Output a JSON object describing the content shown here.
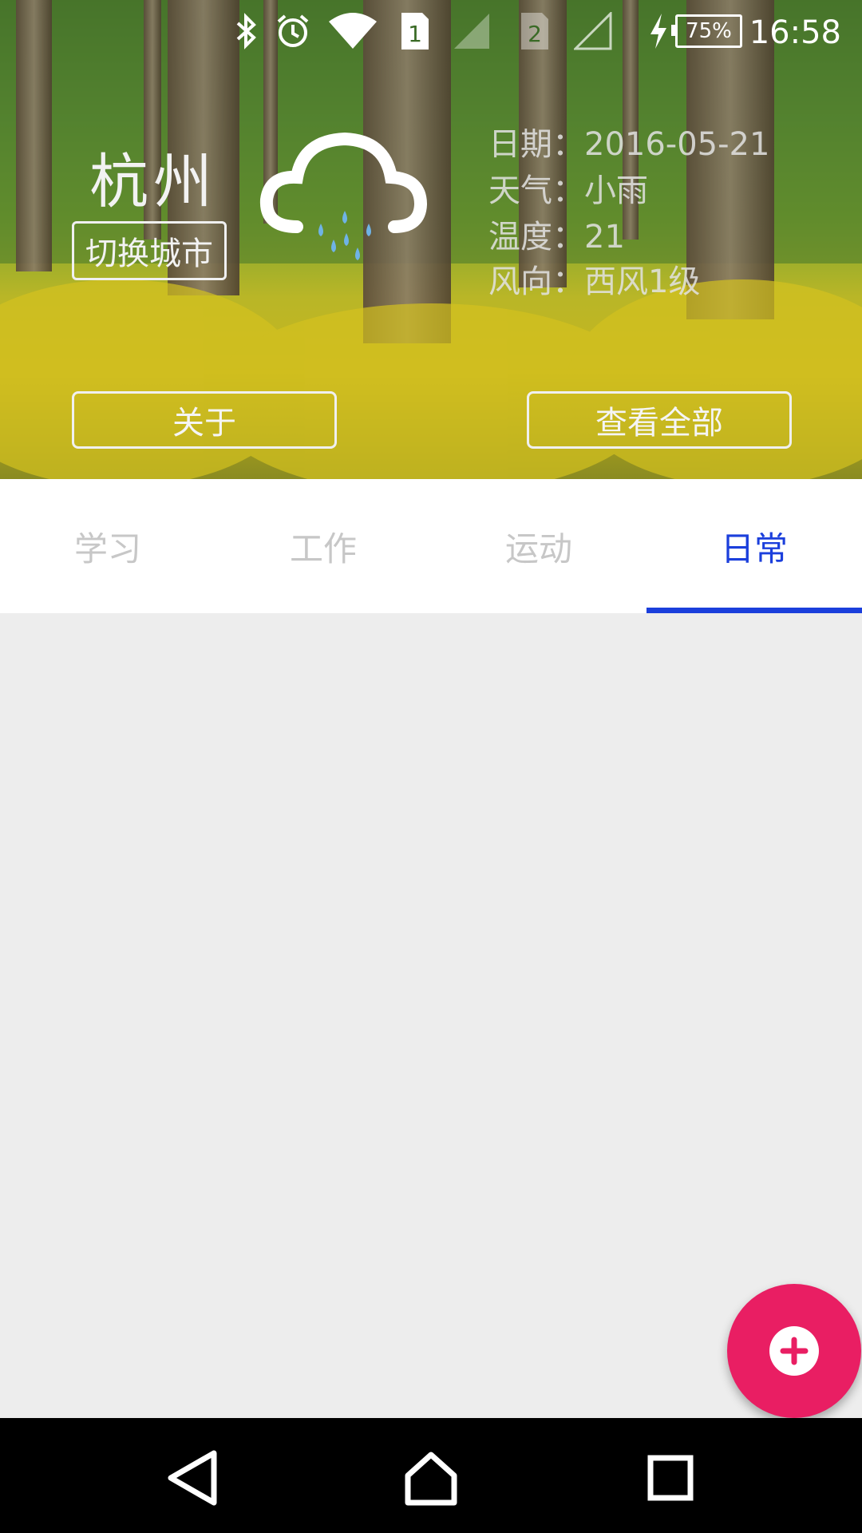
{
  "status_bar": {
    "time": "16:58",
    "battery": "75%",
    "sim1": "1",
    "sim2": "2",
    "icons": [
      "bluetooth-icon",
      "alarm-icon",
      "wifi-icon",
      "sim1-icon",
      "signal-icon",
      "sim2-icon",
      "no-signal-icon",
      "charging-icon",
      "battery-icon"
    ]
  },
  "weather": {
    "city": "杭州",
    "switch_city_label": "切换城市",
    "date_line": "日期：2016-05-21",
    "weather_line": "天气：小雨",
    "temp_line": "温度：21",
    "wind_line": "风向：西风1级",
    "icon": "light-rain-icon"
  },
  "buttons": {
    "about": "关于",
    "view_all": "查看全部"
  },
  "tabs": [
    {
      "label": "学习",
      "active": false
    },
    {
      "label": "工作",
      "active": false
    },
    {
      "label": "运动",
      "active": false
    },
    {
      "label": "日常",
      "active": true
    }
  ],
  "colors": {
    "accent": "#1b3fdc",
    "fab": "#e91e63",
    "tab_inactive": "#c7c7c7",
    "content_bg": "#ededed"
  },
  "fab": {
    "icon": "add-icon"
  },
  "navbar": {
    "icons": [
      "back-icon",
      "home-icon",
      "recents-icon"
    ]
  }
}
